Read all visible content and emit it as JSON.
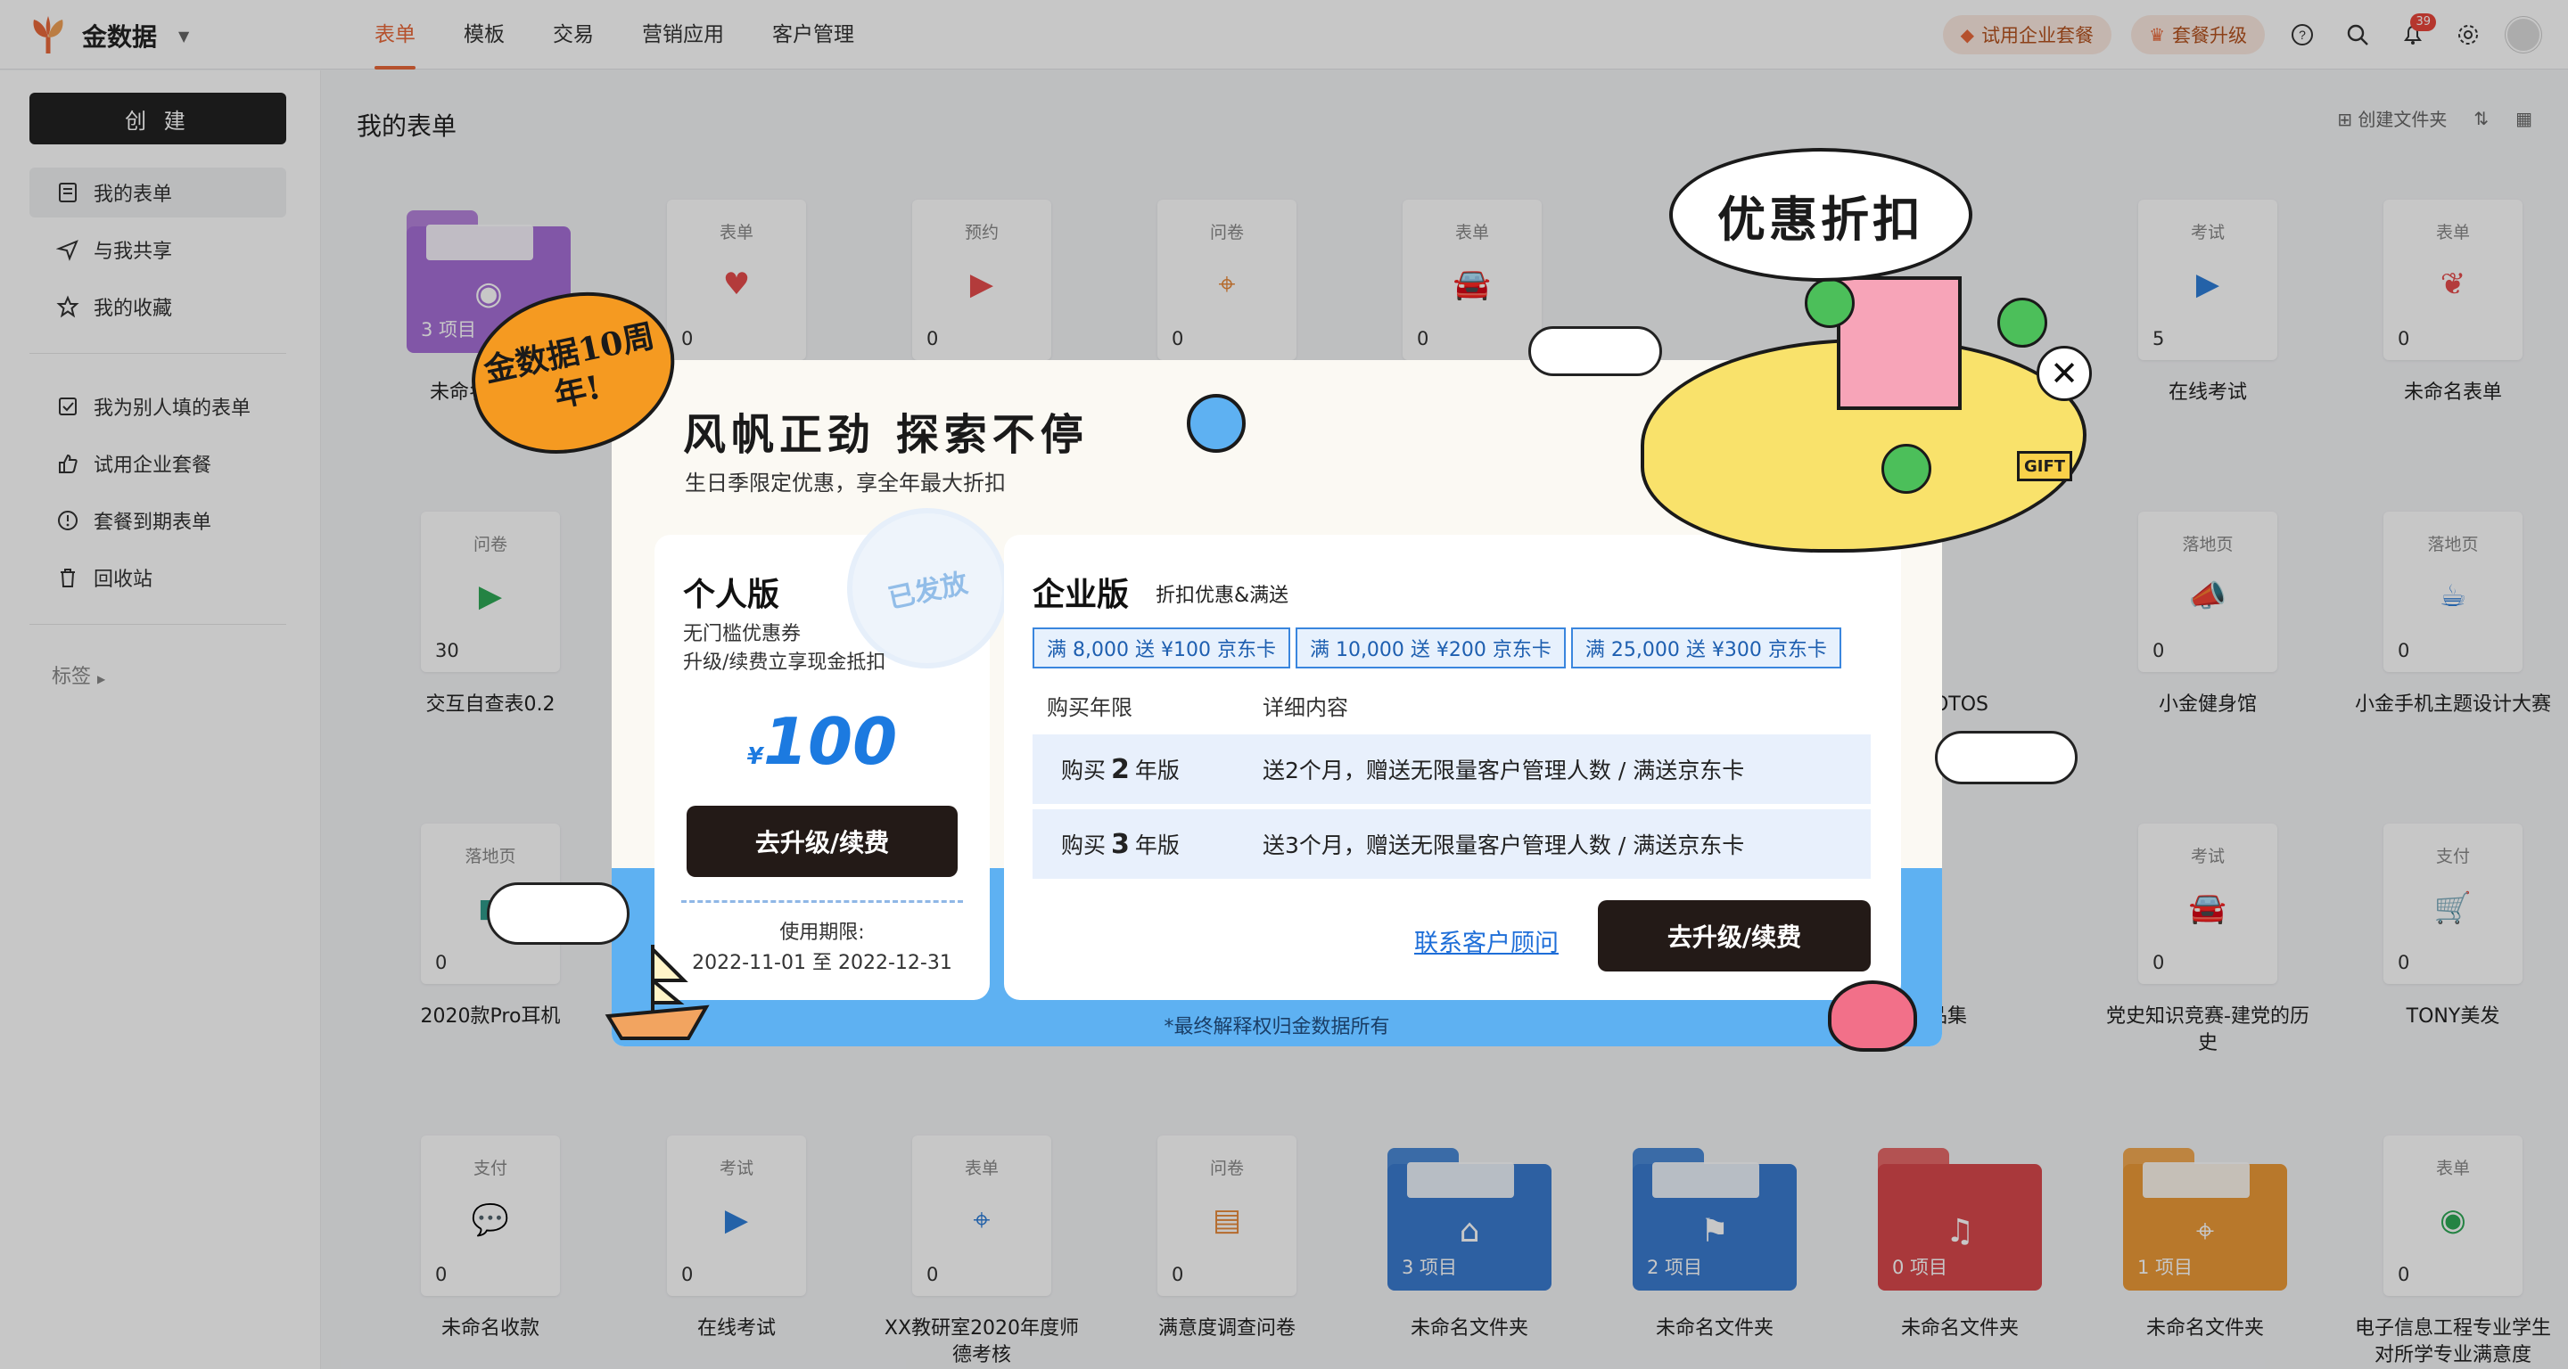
{
  "app": {
    "name": "金数据"
  },
  "nav": {
    "items": [
      "表单",
      "模板",
      "交易",
      "营销应用",
      "客户管理"
    ]
  },
  "topbar": {
    "trial": "试用企业套餐",
    "upgrade": "套餐升级",
    "notif_count": "39"
  },
  "sidebar": {
    "create": "创 建",
    "items": [
      "我的表单",
      "与我共享",
      "我的收藏",
      "我为别人填的表单",
      "试用企业套餐",
      "套餐到期表单",
      "回收站"
    ],
    "tags": "标签"
  },
  "main": {
    "title": "我的表单",
    "create_folder": "创建文件夹"
  },
  "forms": [
    {
      "type": "",
      "count": "3 项目",
      "label": "未命名文件夹"
    },
    {
      "type": "表单",
      "count": "0",
      "label": ""
    },
    {
      "type": "预约",
      "count": "0",
      "label": ""
    },
    {
      "type": "问卷",
      "count": "0",
      "label": ""
    },
    {
      "type": "表单",
      "count": "0",
      "label": ""
    },
    {
      "type": "考试",
      "count": "5",
      "label": "在线考试"
    },
    {
      "type": "表单",
      "count": "0",
      "label": "未命名表单"
    },
    {
      "type": "问卷",
      "count": "30",
      "label": "交互自查表0.2"
    },
    {
      "type": "落地页",
      "count": "0",
      "label": "小金健身馆"
    },
    {
      "type": "落地页",
      "count": "0",
      "label": "小金手机主题设计大赛"
    },
    {
      "type": "落地页",
      "count": "0",
      "label": "2020款Pro耳机"
    },
    {
      "type": "考试",
      "count": "0",
      "label": "党史知识竞赛-建党的历史"
    },
    {
      "type": "支付",
      "count": "0",
      "label": "TONY美发"
    },
    {
      "type": "支付",
      "count": "0",
      "label": "未命名收款"
    },
    {
      "type": "考试",
      "count": "0",
      "label": "在线考试"
    },
    {
      "type": "表单",
      "count": "0",
      "label": "XX教研室2020年度师德考核"
    },
    {
      "type": "问卷",
      "count": "0",
      "label": "满意度调查问卷"
    },
    {
      "type": "表单",
      "count": "0",
      "label": "电子信息工程专业学生对所学专业满意度"
    }
  ],
  "folders": [
    {
      "count": "3 项目",
      "label": "未命名文件夹"
    },
    {
      "count": "2 项目",
      "label": "未命名文件夹"
    },
    {
      "count": "0 项目",
      "label": "未命名文件夹"
    },
    {
      "count": "1 项目",
      "label": "未命名文件夹"
    }
  ],
  "partial_labels": {
    "photos": "PHOTOS",
    "works": "作品集"
  },
  "promo": {
    "badge": "金数据10周年!",
    "bubble": "优惠折扣",
    "title": "风帆正劲 探索不停",
    "subtitle": "生日季限定优惠，享全年最大折扣",
    "personal": {
      "title": "个人版",
      "line1": "无门槛优惠券",
      "line2": "升级/续费立享现金抵扣",
      "stamp": "已发放",
      "currency": "¥",
      "amount": "100",
      "button": "去升级/续费",
      "validity_label": "使用期限:",
      "validity_range": "2022-11-01 至 2022-12-31"
    },
    "enterprise": {
      "title": "企业版",
      "tagline": "折扣优惠&满送",
      "chips": [
        "满 8,000 送 ¥100 京东卡",
        "满 10,000 送 ¥200 京东卡",
        "满 25,000 送 ¥300 京东卡"
      ],
      "col1": "购买年限",
      "col2": "详细内容",
      "rows": [
        {
          "pre": "购买",
          "years": "2",
          "post": "年版",
          "detail": "送2个月，赠送无限量客户管理人数 / 满送京东卡"
        },
        {
          "pre": "购买",
          "years": "3",
          "post": "年版",
          "detail": "送3个月，赠送无限量客户管理人数 / 满送京东卡"
        }
      ],
      "contact": "联系客户顾问",
      "button": "去升级/续费"
    },
    "gift_sign": "GIFT",
    "footer": "*最终解释权归金数据所有"
  },
  "colors": {
    "accent": "#e8683a",
    "primary_dark": "#231a17",
    "link": "#1e6ed8"
  }
}
